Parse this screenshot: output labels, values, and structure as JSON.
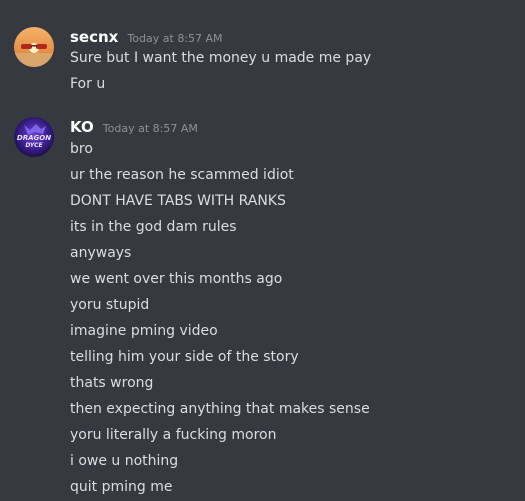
{
  "messages": [
    {
      "username": "secnx",
      "timestamp": "Today at 8:57 AM",
      "avatar_icon": "sunset-beach-avatar-icon",
      "lines": [
        "Sure but I want the money u made me pay",
        "For u"
      ]
    },
    {
      "username": "KO",
      "timestamp": "Today at 8:57 AM",
      "avatar_icon": "dragon-logo-avatar-icon",
      "avatar_text": [
        "DRAGON",
        "DYCE"
      ],
      "lines": [
        "bro",
        "ur the reason he scammed idiot",
        "DONT HAVE TABS WITH RANKS",
        "its in the god dam rules",
        "anyways",
        "we went over this months ago",
        "yoru stupid",
        "imagine pming video",
        "telling him your side of the story",
        "thats wrong",
        "then expecting anything that makes sense",
        "yoru literally a fucking moron",
        "i owe u nothing",
        "quit pming me"
      ]
    }
  ],
  "colors": {
    "background": "#36393f",
    "username": "#ffffff",
    "text": "#dcddde",
    "timestamp": "#8e9297"
  }
}
